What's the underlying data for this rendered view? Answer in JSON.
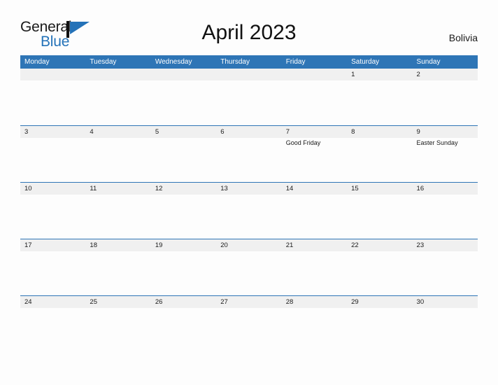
{
  "brand": {
    "name_part1": "General",
    "name_part2": "Blue",
    "flag_icon": "blue-flag-icon",
    "accent_color": "#2472b8"
  },
  "header": {
    "title": "April 2023",
    "locale": "Bolivia"
  },
  "colors": {
    "header_blue": "#2e75b6",
    "day_strip_gray": "#f0f0f0",
    "page_background": "#fdfdfd",
    "text": "#1a1a1a"
  },
  "calendar": {
    "day_headers": [
      "Monday",
      "Tuesday",
      "Wednesday",
      "Thursday",
      "Friday",
      "Saturday",
      "Sunday"
    ],
    "weeks": [
      [
        {
          "day": "",
          "events": []
        },
        {
          "day": "",
          "events": []
        },
        {
          "day": "",
          "events": []
        },
        {
          "day": "",
          "events": []
        },
        {
          "day": "",
          "events": []
        },
        {
          "day": "1",
          "events": []
        },
        {
          "day": "2",
          "events": []
        }
      ],
      [
        {
          "day": "3",
          "events": []
        },
        {
          "day": "4",
          "events": []
        },
        {
          "day": "5",
          "events": []
        },
        {
          "day": "6",
          "events": []
        },
        {
          "day": "7",
          "events": [
            "Good Friday"
          ]
        },
        {
          "day": "8",
          "events": []
        },
        {
          "day": "9",
          "events": [
            "Easter Sunday"
          ]
        }
      ],
      [
        {
          "day": "10",
          "events": []
        },
        {
          "day": "11",
          "events": []
        },
        {
          "day": "12",
          "events": []
        },
        {
          "day": "13",
          "events": []
        },
        {
          "day": "14",
          "events": []
        },
        {
          "day": "15",
          "events": []
        },
        {
          "day": "16",
          "events": []
        }
      ],
      [
        {
          "day": "17",
          "events": []
        },
        {
          "day": "18",
          "events": []
        },
        {
          "day": "19",
          "events": []
        },
        {
          "day": "20",
          "events": []
        },
        {
          "day": "21",
          "events": []
        },
        {
          "day": "22",
          "events": []
        },
        {
          "day": "23",
          "events": []
        }
      ],
      [
        {
          "day": "24",
          "events": []
        },
        {
          "day": "25",
          "events": []
        },
        {
          "day": "26",
          "events": []
        },
        {
          "day": "27",
          "events": []
        },
        {
          "day": "28",
          "events": []
        },
        {
          "day": "29",
          "events": []
        },
        {
          "day": "30",
          "events": []
        }
      ]
    ]
  }
}
